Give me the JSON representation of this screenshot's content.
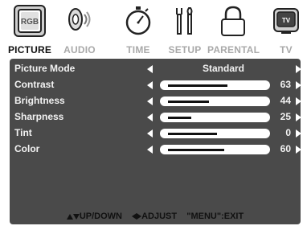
{
  "tabs": [
    {
      "label": "PICTURE",
      "icon": "rgb-picture-icon",
      "icon_text": "RGB",
      "active": true
    },
    {
      "label": "AUDIO",
      "icon": "speaker-icon",
      "active": false
    },
    {
      "label": "TIME",
      "icon": "stopwatch-icon",
      "active": false
    },
    {
      "label": "SETUP",
      "icon": "tools-icon",
      "active": false
    },
    {
      "label": "PARENTAL",
      "icon": "lock-icon",
      "active": false
    },
    {
      "label": "TV",
      "icon": "tv-icon",
      "icon_text": "TV",
      "active": false
    }
  ],
  "menu": {
    "picture_mode": {
      "label": "Picture Mode",
      "value": "Standard"
    },
    "contrast": {
      "label": "Contrast",
      "value": "63",
      "level": 63
    },
    "brightness": {
      "label": "Brightness",
      "value": "44",
      "level": 44
    },
    "sharpness": {
      "label": "Sharpness",
      "value": "25",
      "level": 25
    },
    "tint": {
      "label": "Tint",
      "value": "0",
      "level": 0
    },
    "color": {
      "label": "Color",
      "value": "60",
      "level": 60
    }
  },
  "footer": {
    "navigate": "UP/DOWN",
    "adjust": "ADJUST",
    "exit": "\"MENU\":EXIT"
  },
  "colors": {
    "panel": "#4a4a4a",
    "active_tab_text": "#111111",
    "inactive_tab_text": "#a9a9a9"
  }
}
